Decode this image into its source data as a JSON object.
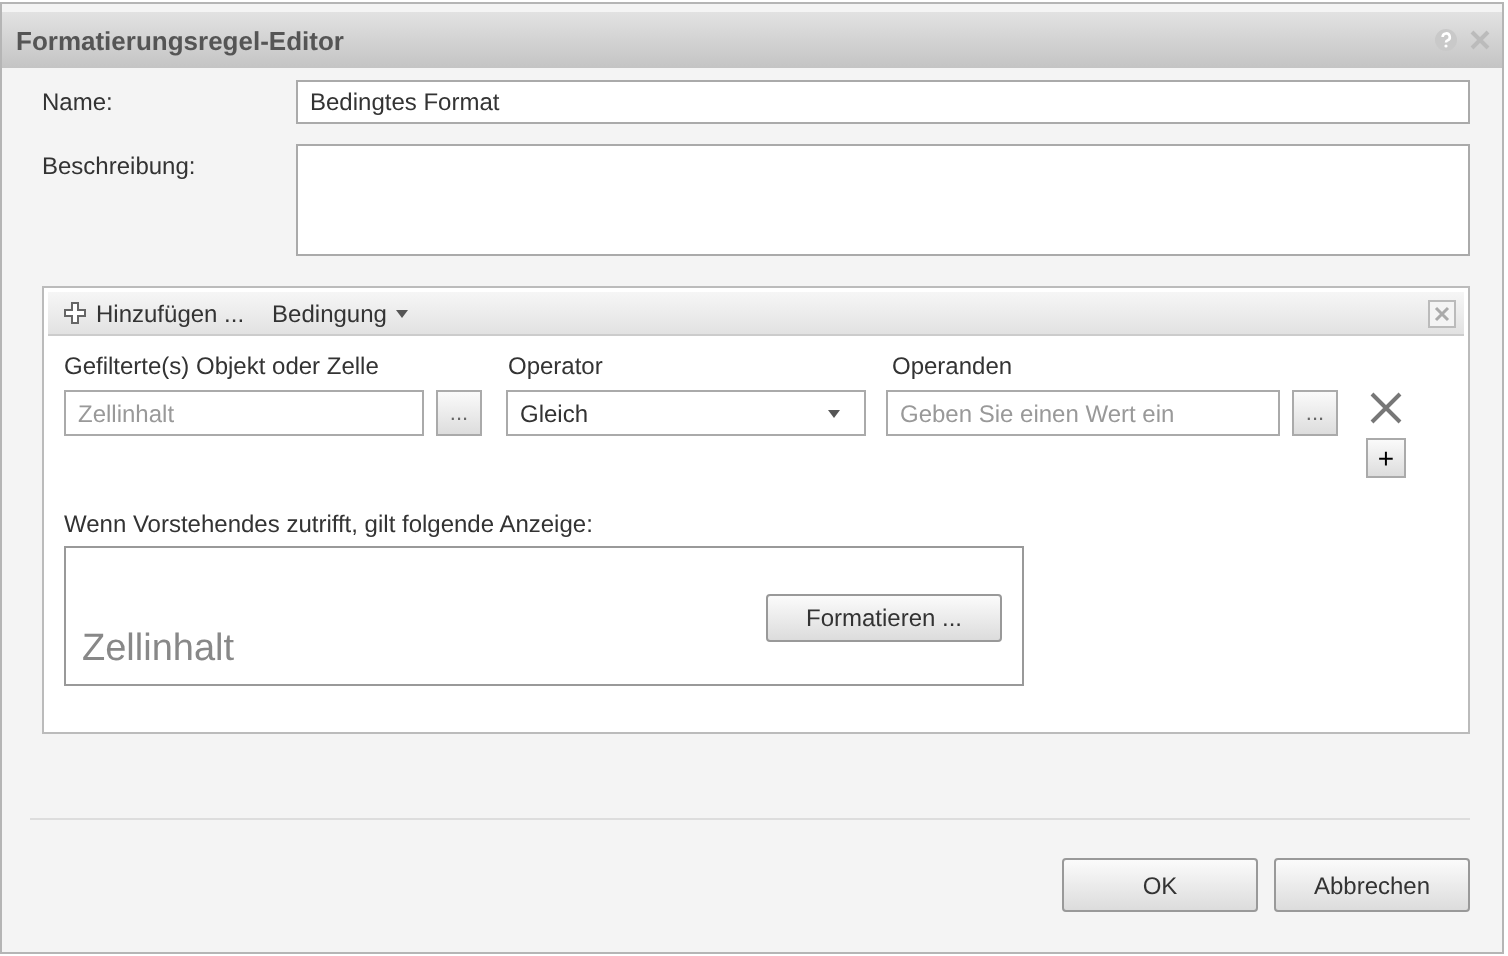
{
  "window": {
    "title": "Formatierungsregel-Editor"
  },
  "name_field": {
    "label": "Name:",
    "value": "Bedingtes Format"
  },
  "description_field": {
    "label": "Beschreibung:"
  },
  "condition_panel": {
    "toolbar": {
      "add_label": "Hinzufügen ...",
      "condition_menu": "Bedingung"
    },
    "columns": [
      "Gefilterte(s) Objekt oder Zelle",
      "Operator",
      "Operanden"
    ],
    "object_field": {
      "placeholder": "Zellinhalt",
      "browse": "..."
    },
    "operator_select": {
      "value": "Gleich"
    },
    "operand_field": {
      "placeholder": "Geben Sie einen Wert ein",
      "browse": "..."
    },
    "add_row_button": "+",
    "display_label": "Wenn Vorstehendes zutrifft, gilt folgende Anzeige:",
    "preview_text": "Zellinhalt",
    "format_button": "Formatieren ..."
  },
  "buttons": [
    "OK",
    "Abbrechen"
  ]
}
